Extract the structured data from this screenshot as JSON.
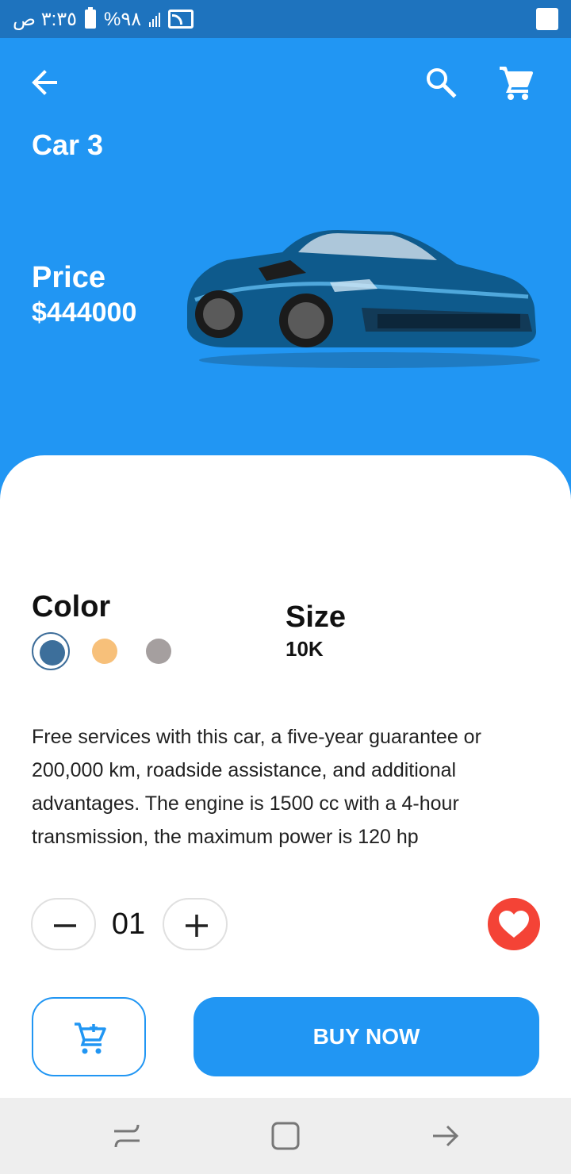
{
  "status_bar": {
    "time": "٣:٣٥ ص",
    "battery": "%٩٨"
  },
  "header": {
    "back_icon": "arrow-back-icon",
    "search_icon": "search-icon",
    "cart_icon": "cart-icon"
  },
  "product": {
    "title": "Car 3",
    "price_label": "Price",
    "price_value": "$444000",
    "image": "blue-convertible-sports-car"
  },
  "details": {
    "color_label": "Color",
    "colors": [
      {
        "hex": "#3D6F9B",
        "selected": true
      },
      {
        "hex": "#F7C07A",
        "selected": false
      },
      {
        "hex": "#A59F9F",
        "selected": false
      }
    ],
    "size_label": "Size",
    "size_value": "10K",
    "description": "Free services with this car, a five-year guarantee or 200,000 km, roadside assistance, and additional advantages. The engine is 1500 cc with a 4-hour transmission, the maximum power is 120 hp"
  },
  "quantity": {
    "value": "01",
    "minus_icon": "minus-icon",
    "plus_icon": "plus-icon"
  },
  "favorite_icon": "heart-icon",
  "actions": {
    "add_to_cart_icon": "add-cart-icon",
    "buy_label": "BUY NOW"
  },
  "colors": {
    "primary": "#2196F3",
    "status_bar": "#1E73BE",
    "favorite": "#F44336"
  }
}
